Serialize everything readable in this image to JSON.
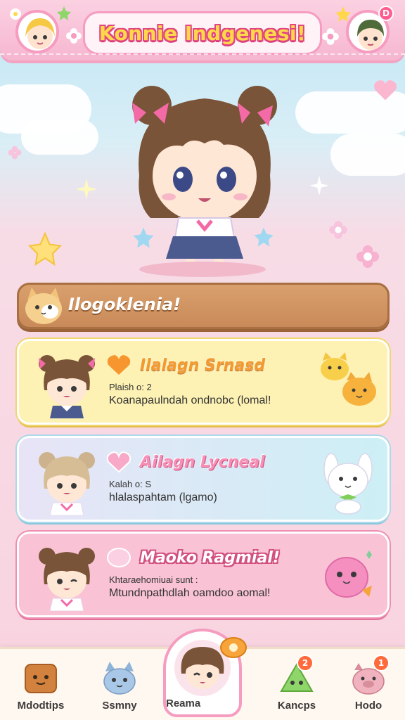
{
  "header": {
    "title": "Konnie Indgenesi!",
    "right_badge": "D"
  },
  "banner": {
    "label": "Ilogoklenia!"
  },
  "cards": [
    {
      "title": "Ilalagn Srnasd",
      "subtitle": "Plaish o: 2",
      "description": "Koanapaulndah ondnobc (lomal!",
      "icon": "heart-icon",
      "pet": "yellow-cat-pets"
    },
    {
      "title": "Ailagn Lycneal",
      "subtitle": "Kalah o: S",
      "description": "hlalaspahtam (lgamo)",
      "icon": "heart-icon",
      "pet": "white-bunny-pet"
    },
    {
      "title": "Maoko Ragmial!",
      "subtitle": "Khtaraehomiuai sunt :",
      "description": "Mtundnpathdlah oamdoo aomal!",
      "icon": "candy-icon",
      "pet": "pink-blob-pet"
    }
  ],
  "nav": {
    "items": [
      {
        "label": "Mdodtips",
        "icon": "box-icon"
      },
      {
        "label": "Ssmny",
        "icon": "cat-icon"
      },
      {
        "label": "Reama",
        "icon": "avatar-icon",
        "badge": ""
      },
      {
        "label": "Kancps",
        "icon": "cheese-icon",
        "badge": "2"
      },
      {
        "label": "Hodo",
        "icon": "pig-icon",
        "badge": "1"
      }
    ]
  },
  "colors": {
    "header_pink": "#f6b6cf",
    "title_yellow": "#ffd84a",
    "banner_brown": "#c88a58",
    "card_yellow": "#fdf2b4",
    "card_blue": "#cdeff6",
    "card_pink": "#f9c3d5"
  }
}
